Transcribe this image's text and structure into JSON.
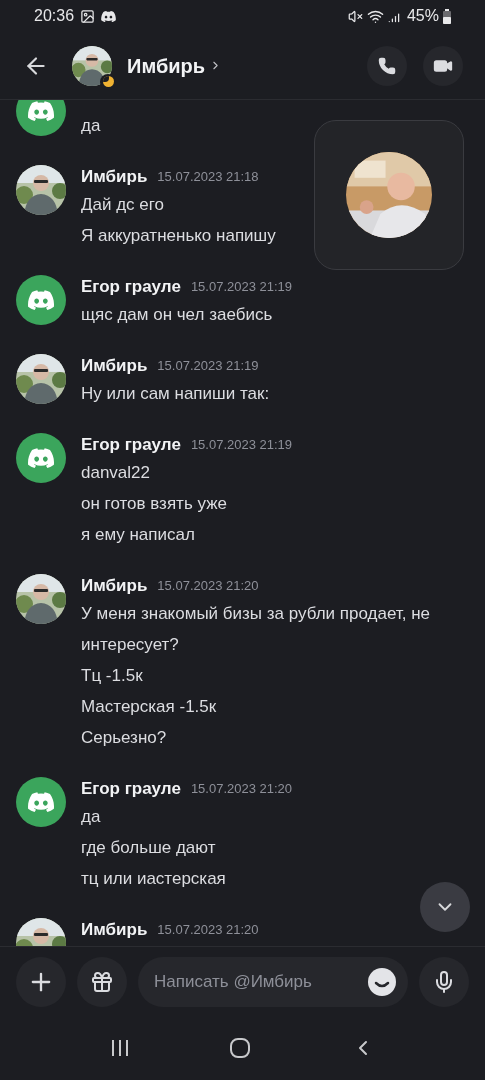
{
  "status_bar": {
    "time": "20:36",
    "battery": "45%"
  },
  "header": {
    "title": "Имбирь",
    "idle": true
  },
  "messages": [
    {
      "avatar": {
        "kind": "logo"
      },
      "lines": [
        "да"
      ]
    },
    {
      "author": "Имбирь",
      "timestamp": "15.07.2023 21:18",
      "avatar": {
        "kind": "picture"
      },
      "lines": [
        "Дай дс его",
        "Я аккуратненько напишу"
      ]
    },
    {
      "author": "Егор грауле",
      "timestamp": "15.07.2023 21:19",
      "avatar": {
        "kind": "logo"
      },
      "lines": [
        "щяс дам он чел заебись"
      ]
    },
    {
      "author": "Имбирь",
      "timestamp": "15.07.2023 21:19",
      "avatar": {
        "kind": "picture"
      },
      "lines": [
        "Ну или сам напиши так:"
      ]
    },
    {
      "author": "Егор грауле",
      "timestamp": "15.07.2023 21:19",
      "avatar": {
        "kind": "logo"
      },
      "lines": [
        "danval22",
        "он готов взять уже",
        "я ему написал"
      ]
    },
    {
      "author": "Имбирь",
      "timestamp": "15.07.2023 21:20",
      "avatar": {
        "kind": "picture"
      },
      "lines": [
        "У меня знакомый бизы за рубли продает, не интересует?",
        "Тц -1.5к",
        "Мастерская -1.5к",
        "Серьезно?"
      ]
    },
    {
      "author": "Егор грауле",
      "timestamp": "15.07.2023 21:20",
      "avatar": {
        "kind": "logo"
      },
      "lines": [
        "да",
        "где больше дают",
        "тц или иастерская"
      ]
    },
    {
      "author": "Имбирь",
      "timestamp": "15.07.2023 21:20",
      "avatar": {
        "kind": "picture"
      }
    }
  ],
  "call_preview": {
    "kind": "picture"
  },
  "composer": {
    "placeholder": "Написать @Имбирь"
  }
}
